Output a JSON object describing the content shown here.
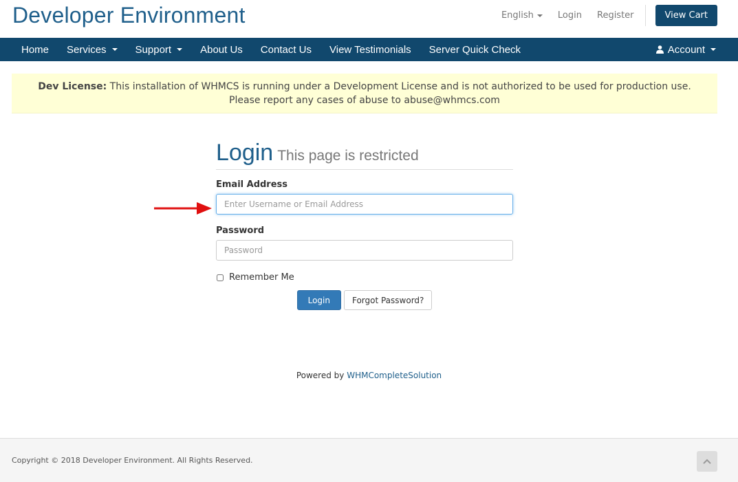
{
  "header": {
    "brand": "Developer Environment",
    "language": "English",
    "login": "Login",
    "register": "Register",
    "view_cart": "View Cart"
  },
  "nav": {
    "home": "Home",
    "services": "Services",
    "support": "Support",
    "about": "About Us",
    "contact": "Contact Us",
    "testimonials": "View Testimonials",
    "server_check": "Server Quick Check",
    "account": "Account"
  },
  "banner": {
    "label": "Dev License:",
    "text": " This installation of WHMCS is running under a Development License and is not authorized to be used for production use. Please report any cases of abuse to abuse@whmcs.com"
  },
  "login": {
    "title": "Login",
    "subtitle": "This page is restricted",
    "email_label": "Email Address",
    "email_placeholder": "Enter Username or Email Address",
    "email_value": "",
    "password_label": "Password",
    "password_placeholder": "Password",
    "password_value": "",
    "remember_label": "Remember Me",
    "remember_checked": false,
    "login_button": "Login",
    "forgot_button": "Forgot Password?"
  },
  "powered": {
    "prefix": "Powered by ",
    "link": "WHMCompleteSolution"
  },
  "footer": {
    "copyright": "Copyright © 2018 Developer Environment. All Rights Reserved."
  },
  "icons": {
    "user": "user-icon",
    "back_to_top": "chevron-up-icon",
    "annotation": "red-arrow-icon"
  },
  "colors": {
    "brand": "#1f5f8b",
    "navbar": "#11486d",
    "primary_button": "#337ab7",
    "banner_bg": "#ffffd6",
    "annotation_arrow": "#e01010"
  }
}
